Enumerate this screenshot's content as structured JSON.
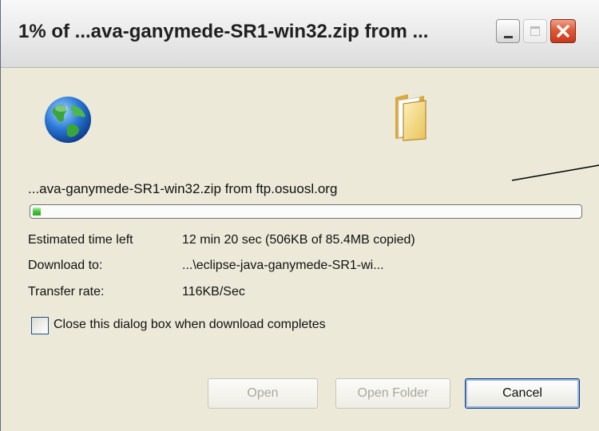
{
  "window": {
    "title": "1% of ...ava-ganymede-SR1-win32.zip from ..."
  },
  "icons": {
    "source": "globe-icon",
    "destination": "folder-icon"
  },
  "transfer": {
    "file_label": "...ava-ganymede-SR1-win32.zip from ftp.osuosl.org",
    "progress_percent": 1
  },
  "details": {
    "time_label": "Estimated time left",
    "time_value": "12 min 20 sec (506KB of 85.4MB copied)",
    "download_label": "Download to:",
    "download_value": "...\\eclipse-java-ganymede-SR1-wi...",
    "rate_label": "Transfer rate:",
    "rate_value": "116KB/Sec"
  },
  "options": {
    "close_when_done_label": "Close this dialog box when download completes",
    "close_when_done_checked": false
  },
  "buttons": {
    "open": "Open",
    "open_folder": "Open Folder",
    "cancel": "Cancel"
  },
  "colors": {
    "progress": "#42c53a",
    "dialog_bg": "#ece9d8",
    "close_button": "#e05a35"
  }
}
